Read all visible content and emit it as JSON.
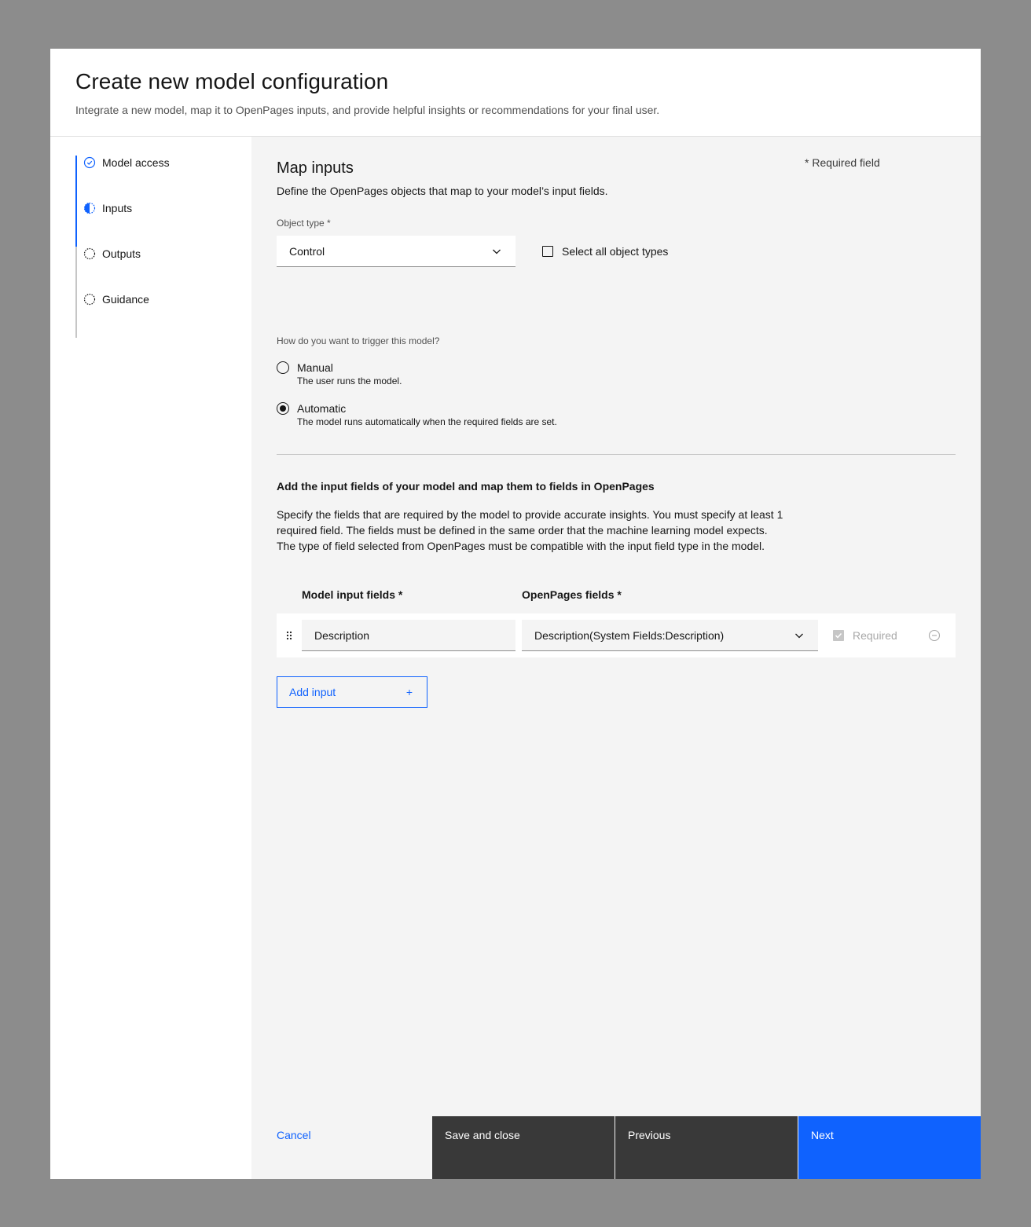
{
  "modal": {
    "title": "Create new model configuration",
    "subtitle": "Integrate a new model, map it to OpenPages inputs, and provide helpful insights or recommendations for your final user."
  },
  "steps": [
    {
      "label": "Model access",
      "state": "complete",
      "icon": "checkmark-circle-icon"
    },
    {
      "label": "Inputs",
      "state": "current",
      "icon": "half-circle-icon"
    },
    {
      "label": "Outputs",
      "state": "incomplete",
      "icon": "dashed-circle-icon"
    },
    {
      "label": "Guidance",
      "state": "incomplete",
      "icon": "dashed-circle-icon"
    }
  ],
  "section": {
    "title": "Map inputs",
    "required_note": "* Required field",
    "description": "Define the OpenPages objects that map to your model’s input fields."
  },
  "object_type": {
    "label": "Object type *",
    "value": "Control",
    "select_all_label": "Select all object types",
    "select_all_checked": false
  },
  "trigger": {
    "label": "How do you want to trigger this model?",
    "options": [
      {
        "title": "Manual",
        "desc": "The user runs the model.",
        "checked": false
      },
      {
        "title": "Automatic",
        "desc": "The model runs automatically when the required fields are set.",
        "checked": true
      }
    ]
  },
  "input_fields": {
    "heading": "Add the input fields of your model and map them to fields in OpenPages",
    "paragraph": "Specify the fields that are required by the model to provide accurate insights. You must specify at least 1 required field. The fields must be defined in the same order that the machine learning model expects. The type of field selected from OpenPages must be compatible with the input field type in the model.",
    "col_model": "Model input fields *",
    "col_openpages": "OpenPages fields *",
    "rows": [
      {
        "model_field": "Description",
        "openpages_field": "Description(System Fields:Description)",
        "required_label": "Required",
        "required_checked": true
      }
    ],
    "add_label": "Add input",
    "add_icon": "+"
  },
  "footer": {
    "cancel": "Cancel",
    "save": "Save and close",
    "previous": "Previous",
    "next": "Next"
  },
  "colors": {
    "accent": "#0f62fe",
    "secondary_button": "#393939",
    "overlay": "#8c8c8c",
    "content_bg": "#f4f4f4"
  }
}
